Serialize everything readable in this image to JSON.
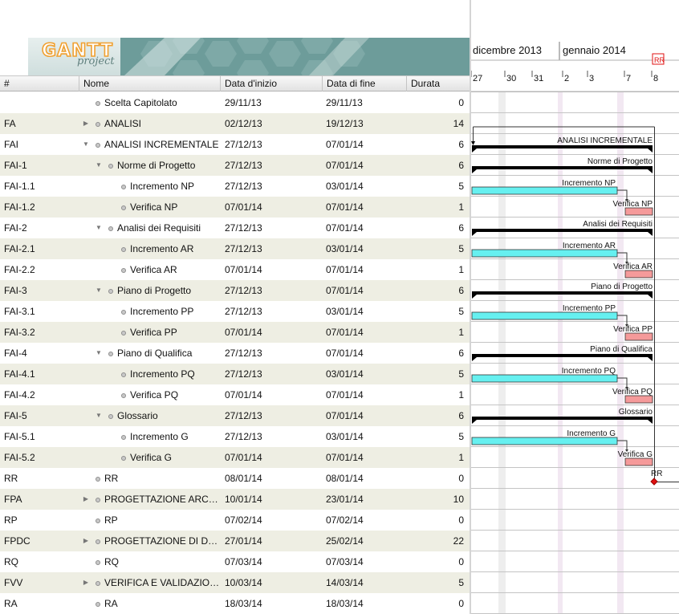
{
  "logo": {
    "brand": "GANTT",
    "product": "project"
  },
  "columns": {
    "id": "#",
    "name": "Nome",
    "start": "Data d'inizio",
    "end": "Data di fine",
    "duration": "Durata"
  },
  "tasks": [
    {
      "id": "",
      "name": "Scelta Capitolato",
      "start": "29/11/13",
      "end": "29/11/13",
      "duration": "0",
      "level": 0,
      "toggle": "none"
    },
    {
      "id": "FA",
      "name": "ANALISI",
      "start": "02/12/13",
      "end": "19/12/13",
      "duration": "14",
      "level": 0,
      "toggle": "collapsed"
    },
    {
      "id": "FAI",
      "name": "ANALISI INCREMENTALE",
      "start": "27/12/13",
      "end": "07/01/14",
      "duration": "6",
      "level": 0,
      "toggle": "expanded"
    },
    {
      "id": "FAI-1",
      "name": "Norme di Progetto",
      "start": "27/12/13",
      "end": "07/01/14",
      "duration": "6",
      "level": 1,
      "toggle": "expanded"
    },
    {
      "id": "FAI-1.1",
      "name": "Incremento NP",
      "start": "27/12/13",
      "end": "03/01/14",
      "duration": "5",
      "level": 2,
      "toggle": "none"
    },
    {
      "id": "FAI-1.2",
      "name": "Verifica NP",
      "start": "07/01/14",
      "end": "07/01/14",
      "duration": "1",
      "level": 2,
      "toggle": "none"
    },
    {
      "id": "FAI-2",
      "name": "Analisi dei Requisiti",
      "start": "27/12/13",
      "end": "07/01/14",
      "duration": "6",
      "level": 1,
      "toggle": "expanded"
    },
    {
      "id": "FAI-2.1",
      "name": "Incremento AR",
      "start": "27/12/13",
      "end": "03/01/14",
      "duration": "5",
      "level": 2,
      "toggle": "none"
    },
    {
      "id": "FAI-2.2",
      "name": "Verifica AR",
      "start": "07/01/14",
      "end": "07/01/14",
      "duration": "1",
      "level": 2,
      "toggle": "none"
    },
    {
      "id": "FAI-3",
      "name": "Piano di Progetto",
      "start": "27/12/13",
      "end": "07/01/14",
      "duration": "6",
      "level": 1,
      "toggle": "expanded"
    },
    {
      "id": "FAI-3.1",
      "name": "Incremento PP",
      "start": "27/12/13",
      "end": "03/01/14",
      "duration": "5",
      "level": 2,
      "toggle": "none"
    },
    {
      "id": "FAI-3.2",
      "name": "Verifica PP",
      "start": "07/01/14",
      "end": "07/01/14",
      "duration": "1",
      "level": 2,
      "toggle": "none"
    },
    {
      "id": "FAI-4",
      "name": "Piano di Qualifica",
      "start": "27/12/13",
      "end": "07/01/14",
      "duration": "6",
      "level": 1,
      "toggle": "expanded"
    },
    {
      "id": "FAI-4.1",
      "name": "Incremento PQ",
      "start": "27/12/13",
      "end": "03/01/14",
      "duration": "5",
      "level": 2,
      "toggle": "none"
    },
    {
      "id": "FAI-4.2",
      "name": "Verifica PQ",
      "start": "07/01/14",
      "end": "07/01/14",
      "duration": "1",
      "level": 2,
      "toggle": "none"
    },
    {
      "id": "FAI-5",
      "name": "Glossario",
      "start": "27/12/13",
      "end": "07/01/14",
      "duration": "6",
      "level": 1,
      "toggle": "expanded"
    },
    {
      "id": "FAI-5.1",
      "name": "Incremento G",
      "start": "27/12/13",
      "end": "03/01/14",
      "duration": "5",
      "level": 2,
      "toggle": "none"
    },
    {
      "id": "FAI-5.2",
      "name": "Verifica G",
      "start": "07/01/14",
      "end": "07/01/14",
      "duration": "1",
      "level": 2,
      "toggle": "none"
    },
    {
      "id": "RR",
      "name": "RR",
      "start": "08/01/14",
      "end": "08/01/14",
      "duration": "0",
      "level": 0,
      "toggle": "none"
    },
    {
      "id": "FPA",
      "name": "PROGETTAZIONE ARC…",
      "start": "10/01/14",
      "end": "23/01/14",
      "duration": "10",
      "level": 0,
      "toggle": "collapsed"
    },
    {
      "id": "RP",
      "name": "RP",
      "start": "07/02/14",
      "end": "07/02/14",
      "duration": "0",
      "level": 0,
      "toggle": "none"
    },
    {
      "id": "FPDC",
      "name": "PROGETTAZIONE DI D…",
      "start": "27/01/14",
      "end": "25/02/14",
      "duration": "22",
      "level": 0,
      "toggle": "collapsed"
    },
    {
      "id": "RQ",
      "name": "RQ",
      "start": "07/03/14",
      "end": "07/03/14",
      "duration": "0",
      "level": 0,
      "toggle": "none"
    },
    {
      "id": "FVV",
      "name": "VERIFICA E VALIDAZIO…",
      "start": "10/03/14",
      "end": "14/03/14",
      "duration": "5",
      "level": 0,
      "toggle": "collapsed"
    },
    {
      "id": "RA",
      "name": "RA",
      "start": "18/03/14",
      "end": "18/03/14",
      "duration": "0",
      "level": 0,
      "toggle": "none"
    }
  ],
  "timeline": {
    "months": [
      "dicembre 2013",
      "gennaio 2014"
    ],
    "days": [
      "27",
      "30",
      "31",
      "2",
      "3",
      "7",
      "8"
    ],
    "milestone_flag": "RR"
  },
  "gantt_bars": [
    {
      "row": 2,
      "type": "summary",
      "label": "ANALISI INCREMENTALE"
    },
    {
      "row": 3,
      "type": "summary",
      "label": "Norme di Progetto"
    },
    {
      "row": 4,
      "type": "task",
      "label": "Incremento NP"
    },
    {
      "row": 5,
      "type": "verify",
      "label": "Verifica NP"
    },
    {
      "row": 6,
      "type": "summary",
      "label": "Analisi dei Requisiti"
    },
    {
      "row": 7,
      "type": "task",
      "label": "Incremento AR"
    },
    {
      "row": 8,
      "type": "verify",
      "label": "Verifica AR"
    },
    {
      "row": 9,
      "type": "summary",
      "label": "Piano di Progetto"
    },
    {
      "row": 10,
      "type": "task",
      "label": "Incremento PP"
    },
    {
      "row": 11,
      "type": "verify",
      "label": "Verifica PP"
    },
    {
      "row": 12,
      "type": "summary",
      "label": "Piano di Qualifica"
    },
    {
      "row": 13,
      "type": "task",
      "label": "Incremento PQ"
    },
    {
      "row": 14,
      "type": "verify",
      "label": "Verifica PQ"
    },
    {
      "row": 15,
      "type": "summary",
      "label": "Glossario"
    },
    {
      "row": 16,
      "type": "task",
      "label": "Incremento G"
    },
    {
      "row": 17,
      "type": "verify",
      "label": "Verifica G"
    },
    {
      "row": 18,
      "type": "milestone",
      "label": "RR"
    }
  ],
  "colors": {
    "row_alt": "#eeeee3",
    "task_fill": "#66f0f0",
    "verify_fill": "#f59a9a",
    "summary_fill": "#000000",
    "milestone": "#e01010",
    "weekend": "#eeeeee",
    "logo_bg": "#6d9c9a"
  }
}
